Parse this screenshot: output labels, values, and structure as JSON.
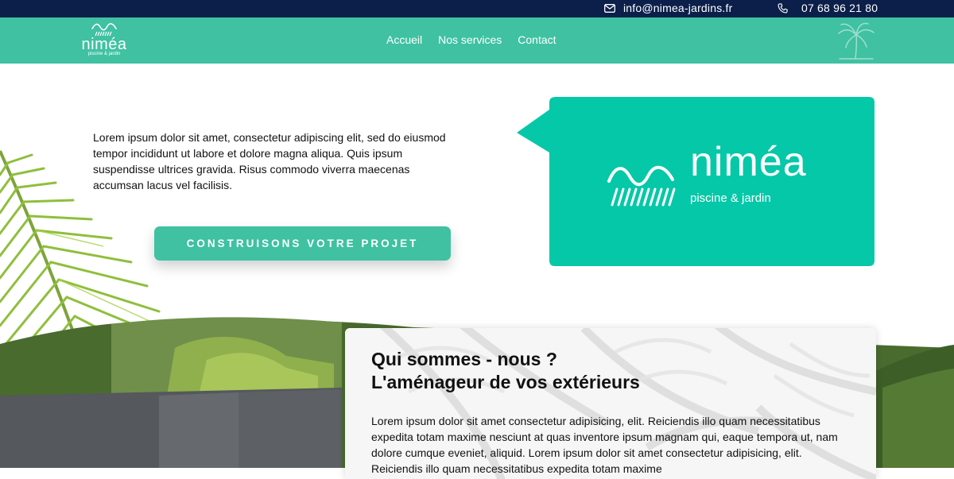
{
  "topbar": {
    "email": "info@nimea-jardins.fr",
    "phone": "07 68 96 21 80",
    "email_icon": "envelope-icon",
    "phone_icon": "phone-icon"
  },
  "header": {
    "logo_brand": "niméa",
    "logo_tagline": "piscine & jardin",
    "nav": [
      "Accueil",
      "Nos services",
      "Contact"
    ],
    "palm_icon": "palm-tree-icon"
  },
  "hero": {
    "text": "Lorem ipsum dolor sit amet, consectetur adipiscing elit, sed do eiusmod tempor incididunt ut labore et dolore magna aliqua. Quis ipsum suspendisse ultrices gravida. Risus commodo viverra maecenas accumsan lacus vel facilisis.",
    "cta_label": "CONSTRUISONS VOTRE PROJET",
    "bubble_brand": "niméa",
    "bubble_tagline": "piscine & jardin"
  },
  "about": {
    "title_line1": "Qui sommes - nous ?",
    "title_line2": "L'aménageur de vos extérieurs",
    "text": "Lorem ipsum dolor sit amet consectetur adipisicing, elit. Reiciendis illo quam necessitatibus expedita totam maxime nesciunt at quas inventore ipsum magnam qui, eaque tempora ut, nam dolore cumque eveniet, aliquid. Lorem ipsum dolor sit amet consectetur adipisicing, elit. Reiciendis illo quam necessitatibus expedita totam maxime"
  },
  "colors": {
    "topbar": "#0b1f4a",
    "nav": "#3fc1a2",
    "bubble": "#05c8a8",
    "cta": "#3fc1a2"
  }
}
